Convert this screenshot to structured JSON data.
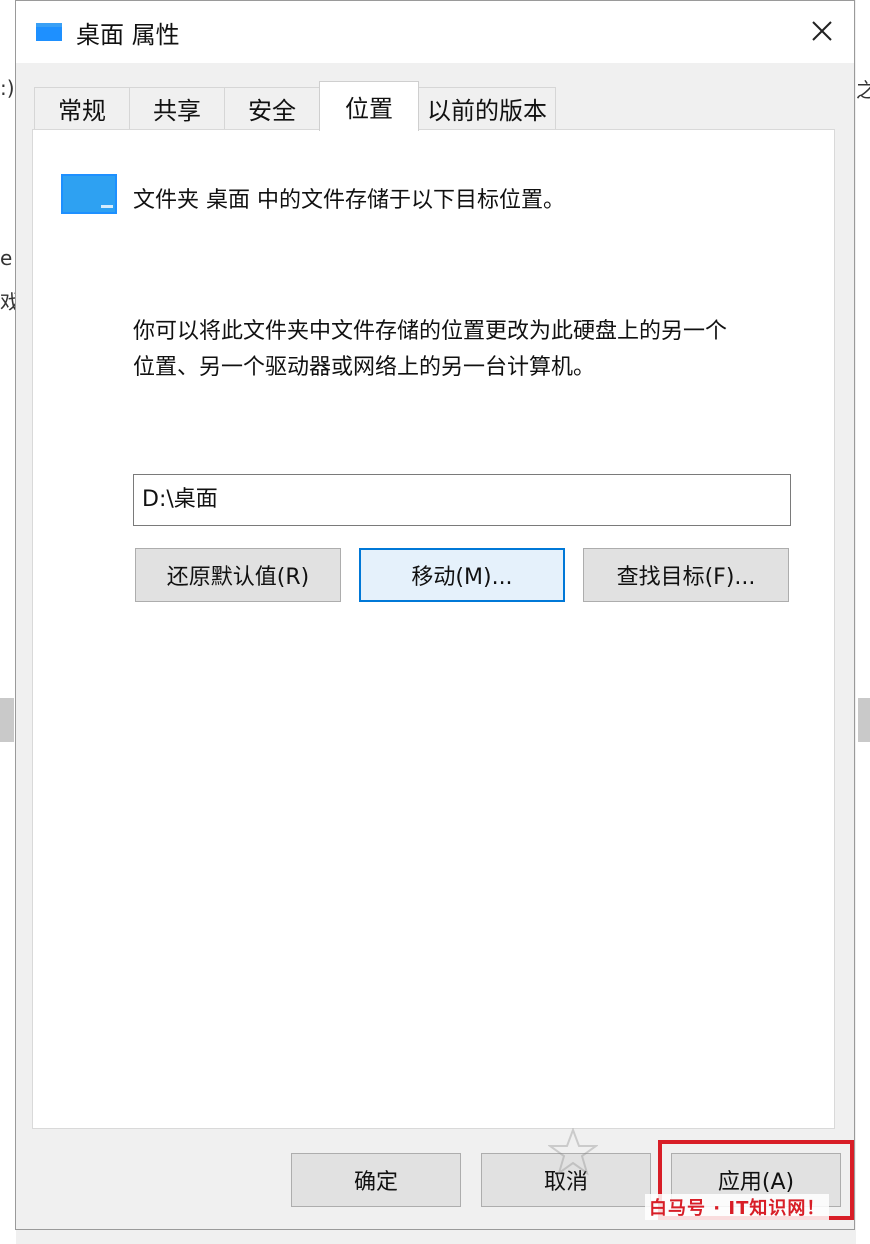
{
  "window": {
    "title": "桌面 属性",
    "accent": "#0078d7",
    "folder_color": "#1e90ff"
  },
  "tabs": [
    {
      "label": "常规"
    },
    {
      "label": "共享"
    },
    {
      "label": "安全"
    },
    {
      "label": "位置",
      "active": true
    },
    {
      "label": "以前的版本"
    }
  ],
  "location": {
    "description": "文件夹 桌面 中的文件存储于以下目标位置。",
    "explanation_line1": "你可以将此文件夹中文件存储的位置更改为此硬盘上的另一个",
    "explanation_line2": "位置、另一个驱动器或网络上的另一台计算机。",
    "path_value": "D:\\桌面",
    "restore_label": "还原默认值(R)",
    "move_label": "移动(M)...",
    "find_label": "查找目标(F)..."
  },
  "footer": {
    "ok_label": "确定",
    "cancel_label": "取消",
    "apply_label": "应用(A)"
  },
  "background": {
    "left_fragments": [
      ":)",
      "e",
      "戏"
    ],
    "right_fragment": "之"
  },
  "watermark": {
    "text": "白马号 · IT知识网！",
    "highlight_color": "#d81e27"
  }
}
